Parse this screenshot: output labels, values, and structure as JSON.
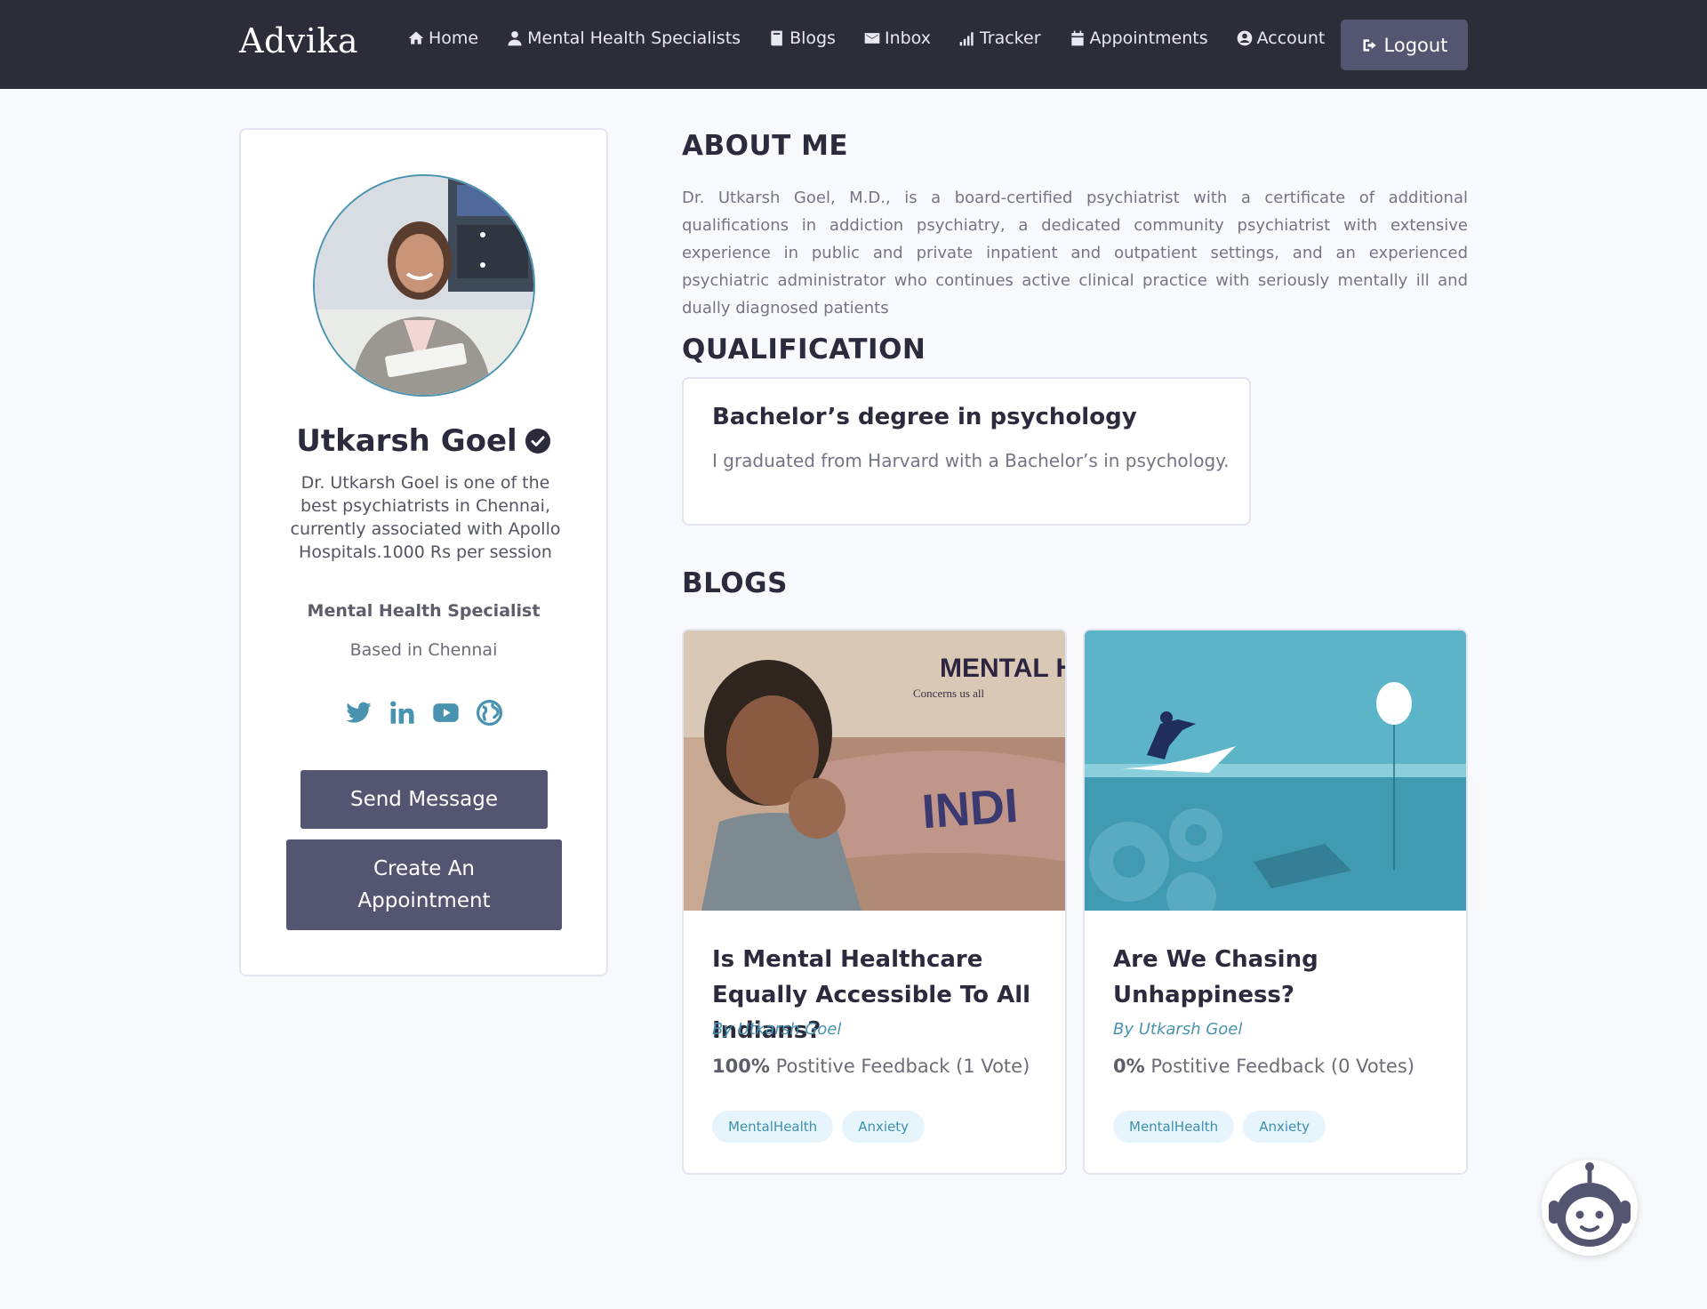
{
  "brand": "Advika",
  "nav": {
    "items": [
      {
        "label": "Home",
        "icon": "home-icon"
      },
      {
        "label": "Mental Health Specialists",
        "icon": "user-doctor-icon"
      },
      {
        "label": "Blogs",
        "icon": "book-icon"
      },
      {
        "label": "Inbox",
        "icon": "envelope-icon"
      },
      {
        "label": "Tracker",
        "icon": "signal-icon"
      },
      {
        "label": "Appointments",
        "icon": "calendar-icon"
      },
      {
        "label": "Account",
        "icon": "user-circle-icon"
      }
    ],
    "logout_label": "Logout"
  },
  "profile": {
    "name": "Utkarsh Goel",
    "bio": "Dr. Utkarsh Goel is one of the best psychiatrists in Chennai, currently associated with Apollo Hospitals.1000 Rs per session",
    "role": "Mental Health Specialist",
    "location": "Based in Chennai",
    "social": [
      "twitter-icon",
      "linkedin-icon",
      "youtube-icon",
      "globe-icon"
    ],
    "send_message_label": "Send Message",
    "create_appointment_label": "Create An Appointment"
  },
  "about": {
    "heading": "ABOUT ME",
    "text": "Dr. Utkarsh Goel, M.D., is a board-certified psychiatrist with a certificate of additional qualifications in addiction psychiatry, a dedicated community psychiatrist with extensive experience in public and private inpatient and outpatient settings, and an experienced psychiatric administrator who continues active clinical practice with seriously mentally ill and dually diagnosed patients"
  },
  "qualification": {
    "heading": "QUALIFICATION",
    "title": "Bachelor’s degree in psychology",
    "description": "I graduated from Harvard with a Bachelor’s in psychology."
  },
  "blogs": {
    "heading": "BLOGS",
    "items": [
      {
        "title": "Is Mental Healthcare Equally Accessible To All Indians?",
        "author": "By Utkarsh Goel",
        "feedback_pct": "100%",
        "feedback_text": " Postitive Feedback (1 Vote)",
        "tags": [
          "MentalHealth",
          "Anxiety"
        ],
        "image_banner": "MENTAL HEAL",
        "image_sub": "Concerns us all",
        "image_text": "INDI"
      },
      {
        "title": "Are We Chasing Unhappiness?",
        "author": "By Utkarsh Goel",
        "feedback_pct": "0%",
        "feedback_text": " Postitive Feedback (0 Votes)",
        "tags": [
          "MentalHealth",
          "Anxiety"
        ]
      }
    ]
  },
  "colors": {
    "navbar": "#2d2d3a",
    "button": "#545671",
    "accent": "#4a93b0",
    "tag_bg": "#e6f5fb"
  }
}
